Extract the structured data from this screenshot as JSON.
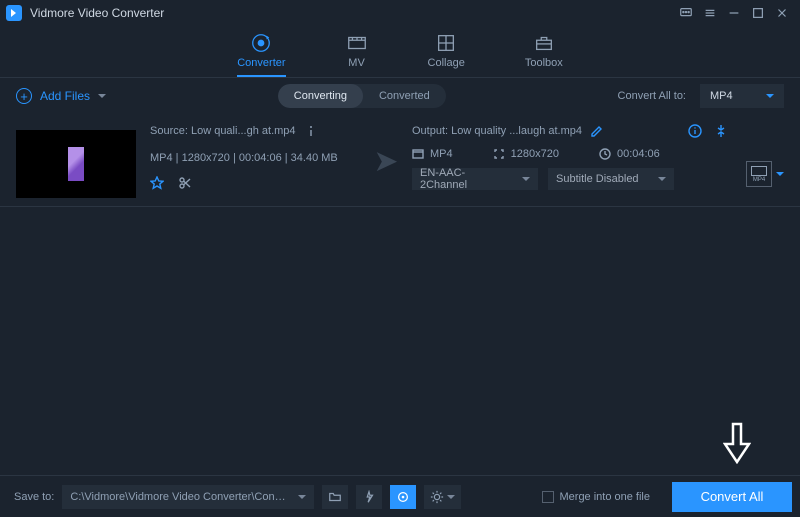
{
  "app": {
    "title": "Vidmore Video Converter"
  },
  "nav": {
    "converter": "Converter",
    "mv": "MV",
    "collage": "Collage",
    "toolbox": "Toolbox"
  },
  "toolbar": {
    "add_files": "Add Files",
    "seg_converting": "Converting",
    "seg_converted": "Converted",
    "convert_all_to": "Convert All to:",
    "format_value": "MP4"
  },
  "item": {
    "source_label": "Source: Low quali...gh at.mp4",
    "props": "MP4 | 1280x720 | 00:04:06 | 34.40 MB",
    "output_label": "Output: Low quality ...laugh at.mp4",
    "out_format": "MP4",
    "out_resolution": "1280x720",
    "out_duration": "00:04:06",
    "audio_track": "EN-AAC-2Channel",
    "subtitle": "Subtitle Disabled",
    "profile_sub": "MP4"
  },
  "footer": {
    "save_to_label": "Save to:",
    "save_path": "C:\\Vidmore\\Vidmore Video Converter\\Converted",
    "merge_label": "Merge into one file",
    "convert_all_btn": "Convert All"
  }
}
